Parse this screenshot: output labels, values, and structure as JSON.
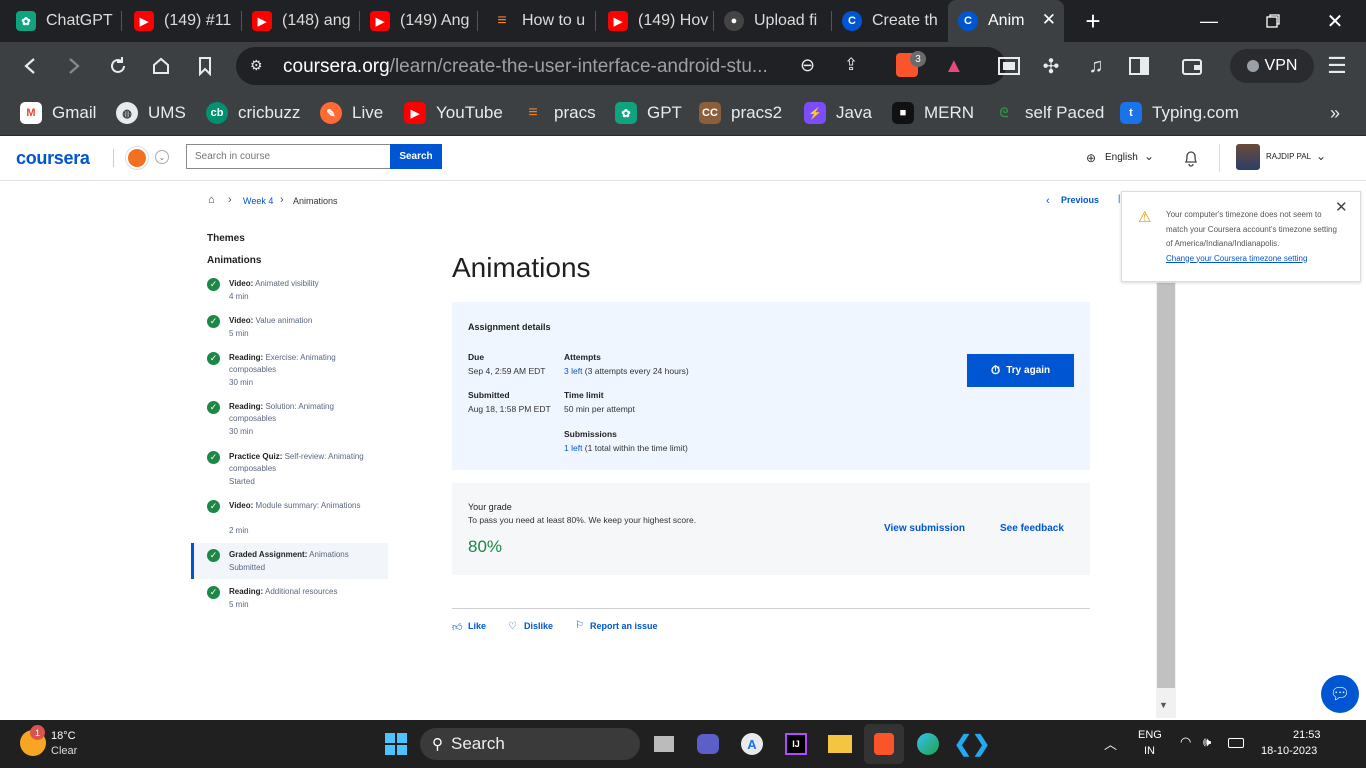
{
  "browser": {
    "tabs": [
      {
        "label": "ChatGPT",
        "icon": "chatgpt-icon",
        "color": "#10a37f"
      },
      {
        "label": "(149) #11",
        "icon": "youtube-icon",
        "color": "#ff0000"
      },
      {
        "label": "(148) ang",
        "icon": "youtube-icon",
        "color": "#ff0000"
      },
      {
        "label": "(149) Ang",
        "icon": "youtube-icon",
        "color": "#ff0000"
      },
      {
        "label": "How to u",
        "icon": "stackoverflow-icon",
        "color": "#f48024"
      },
      {
        "label": "(149) Hov",
        "icon": "youtube-icon",
        "color": "#ff0000"
      },
      {
        "label": "Upload fi",
        "icon": "github-icon",
        "color": "#555555"
      },
      {
        "label": "Create th",
        "icon": "coursera-icon",
        "color": "#0056d2"
      },
      {
        "label": "Anim",
        "icon": "coursera-icon",
        "color": "#0056d2"
      }
    ],
    "url_host": "coursera.org",
    "url_path": "/learn/create-the-user-interface-android-stu...",
    "brave_badge": "3",
    "vpn_label": "VPN",
    "bookmarks": [
      {
        "label": "Gmail",
        "icon": "gmail-icon",
        "color": "#ea4335"
      },
      {
        "label": "UMS",
        "icon": "globe-icon",
        "color": "#5f6368"
      },
      {
        "label": "cricbuzz",
        "icon": "cricbuzz-icon",
        "color": "#009270"
      },
      {
        "label": "Live",
        "icon": "live-icon",
        "color": "#ff6b35"
      },
      {
        "label": "YouTube",
        "icon": "youtube-icon",
        "color": "#ff0000"
      },
      {
        "label": "pracs",
        "icon": "stackoverflow-icon",
        "color": "#f48024"
      },
      {
        "label": "GPT",
        "icon": "chatgpt-icon",
        "color": "#10a37f"
      },
      {
        "label": "pracs2",
        "icon": "cc-icon",
        "color": "#8b5e3c"
      },
      {
        "label": "Java",
        "icon": "bolt-icon",
        "color": "#7c4dff"
      },
      {
        "label": "MERN",
        "icon": "cube-icon",
        "color": "#111111"
      },
      {
        "label": "self Paced",
        "icon": "gfg-icon",
        "color": "#2f8d46"
      },
      {
        "label": "Typing.com",
        "icon": "typing-icon",
        "color": "#1a73e8"
      }
    ]
  },
  "header": {
    "logo": "coursera",
    "search_placeholder": "Search in course",
    "search_button": "Search",
    "language": "English",
    "user_name": "RAJDIP PAL"
  },
  "breadcrumb": {
    "week": "Week 4",
    "current": "Animations"
  },
  "sidebar": {
    "themes_label": "Themes",
    "section": "Animations",
    "items": [
      {
        "type": "Video:",
        "name": "Animated visibility",
        "meta": "4 min"
      },
      {
        "type": "Video:",
        "name": "Value animation",
        "meta": "5 min"
      },
      {
        "type": "Reading:",
        "name": "Exercise: Animating composables",
        "meta": "30 min"
      },
      {
        "type": "Reading:",
        "name": "Solution: Animating composables",
        "meta": "30 min"
      },
      {
        "type": "Practice Quiz:",
        "name": "Self-review: Animating composables",
        "meta": "Started"
      },
      {
        "type": "Video:",
        "name": "Module summary: Animations",
        "meta": "2 min"
      },
      {
        "type": "Graded Assignment:",
        "name": "Animations",
        "meta": "Submitted"
      },
      {
        "type": "Reading:",
        "name": "Additional resources",
        "meta": "5 min"
      }
    ]
  },
  "main": {
    "previous": "Previous",
    "title": "Animations",
    "details_heading": "Assignment details",
    "due_label": "Due",
    "due_value": "Sep 4, 2:59 AM EDT",
    "submitted_label": "Submitted",
    "submitted_value": "Aug 18, 1:58 PM EDT",
    "attempts_label": "Attempts",
    "attempts_left": "3 left",
    "attempts_rest": " (3 attempts every 24 hours)",
    "time_limit_label": "Time limit",
    "time_limit_value": "50 min per attempt",
    "submissions_label": "Submissions",
    "submissions_left": "1 left",
    "submissions_rest": " (1 total within the time limit)",
    "try_again": "Try again",
    "grade_heading": "Your grade",
    "grade_note": "To pass you need at least 80%. We keep your highest score.",
    "grade_value": "80%",
    "view_submission": "View submission",
    "see_feedback": "See feedback",
    "like": "Like",
    "dislike": "Dislike",
    "report": "Report an issue"
  },
  "toast": {
    "message": "Your computer's timezone does not seem to match your Coursera account's timezone setting of America/Indiana/Indianapolis.",
    "link": "Change your Coursera timezone setting"
  },
  "taskbar": {
    "weather_temp": "18°C",
    "weather_desc": "Clear",
    "weather_badge": "1",
    "search_label": "Search",
    "lang_top": "ENG",
    "lang_bottom": "IN",
    "time": "21:53",
    "date": "18-10-2023"
  }
}
